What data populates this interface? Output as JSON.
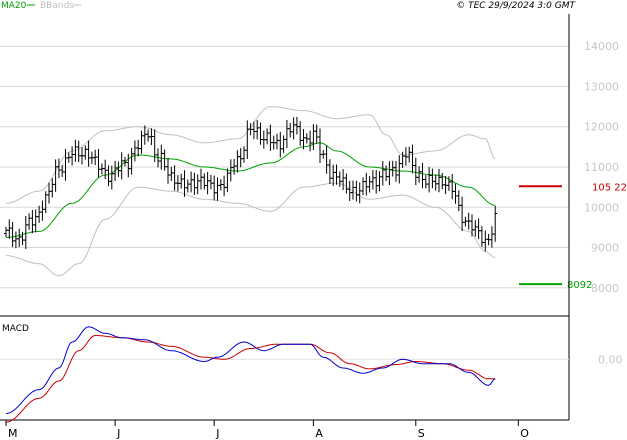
{
  "header": {
    "legend": [
      {
        "label": "MA20",
        "color": "#00a000"
      },
      {
        "label": "BBands",
        "color": "#c0c0c0"
      }
    ],
    "source": "© TEC 29/9/2024 3:0 GMT"
  },
  "colors": {
    "price_bar": "#000000",
    "ma20": "#00a000",
    "bbands": "#c0c0c0",
    "grid": "#d8d8d8",
    "macd": "#0000cc",
    "signal": "#cc0000",
    "resistance": "#cc0000",
    "support": "#00a000"
  },
  "macd_pane": {
    "title": "MACD",
    "tick_label": "0.00"
  },
  "levels": {
    "resistance": {
      "value": 10522,
      "label": "105 22"
    },
    "support": {
      "value": 8092,
      "label": "8092"
    }
  },
  "chart_data": {
    "type": "ohlc",
    "y_ticks": [
      {
        "value": 8000,
        "label": "8000"
      },
      {
        "value": 9000,
        "label": "9000"
      },
      {
        "value": 10000,
        "label": "10000"
      },
      {
        "value": 11000,
        "label": "11000"
      },
      {
        "value": 12000,
        "label": "12000"
      },
      {
        "value": 13000,
        "label": "13000"
      },
      {
        "value": 14000,
        "label": "14000"
      }
    ],
    "ylim": [
      7300,
      14800
    ],
    "x_labels": [
      "M",
      "J",
      "J",
      "A",
      "S",
      "O"
    ],
    "x_label_index": [
      0,
      33,
      63,
      93,
      124,
      155
    ],
    "n_bars": 155,
    "price_knots": [
      [
        0,
        9350
      ],
      [
        4,
        9250
      ],
      [
        8,
        9650
      ],
      [
        12,
        10200
      ],
      [
        16,
        11000
      ],
      [
        20,
        11300
      ],
      [
        24,
        11400
      ],
      [
        28,
        11000
      ],
      [
        32,
        10800
      ],
      [
        36,
        11100
      ],
      [
        40,
        11500
      ],
      [
        43,
        11900
      ],
      [
        46,
        11200
      ],
      [
        50,
        10800
      ],
      [
        54,
        10500
      ],
      [
        58,
        10700
      ],
      [
        62,
        10500
      ],
      [
        66,
        10600
      ],
      [
        70,
        11200
      ],
      [
        74,
        11900
      ],
      [
        78,
        11800
      ],
      [
        82,
        11500
      ],
      [
        86,
        12000
      ],
      [
        90,
        11700
      ],
      [
        93,
        11800
      ],
      [
        96,
        11200
      ],
      [
        99,
        10800
      ],
      [
        103,
        10500
      ],
      [
        107,
        10400
      ],
      [
        111,
        10700
      ],
      [
        115,
        10800
      ],
      [
        118,
        11000
      ],
      [
        121,
        11300
      ],
      [
        124,
        10900
      ],
      [
        128,
        10600
      ],
      [
        132,
        10700
      ],
      [
        135,
        10400
      ],
      [
        138,
        9800
      ],
      [
        141,
        9500
      ],
      [
        143,
        9300
      ],
      [
        146,
        9200
      ],
      [
        148,
        9700
      ]
    ],
    "ma20_knots": [
      [
        0,
        9250
      ],
      [
        10,
        9400
      ],
      [
        20,
        10100
      ],
      [
        30,
        10800
      ],
      [
        40,
        11300
      ],
      [
        50,
        11200
      ],
      [
        60,
        11000
      ],
      [
        70,
        10900
      ],
      [
        80,
        11100
      ],
      [
        90,
        11500
      ],
      [
        95,
        11600
      ],
      [
        100,
        11400
      ],
      [
        110,
        11000
      ],
      [
        120,
        10900
      ],
      [
        130,
        10800
      ],
      [
        140,
        10500
      ],
      [
        148,
        10050
      ]
    ],
    "bb_upper_knots": [
      [
        0,
        10100
      ],
      [
        10,
        10400
      ],
      [
        20,
        11400
      ],
      [
        30,
        11900
      ],
      [
        40,
        12000
      ],
      [
        50,
        11800
      ],
      [
        60,
        11600
      ],
      [
        70,
        11700
      ],
      [
        80,
        12500
      ],
      [
        90,
        12400
      ],
      [
        100,
        12200
      ],
      [
        110,
        12300
      ],
      [
        115,
        11800
      ],
      [
        120,
        11300
      ],
      [
        130,
        11400
      ],
      [
        140,
        11800
      ],
      [
        145,
        11700
      ],
      [
        148,
        11200
      ]
    ],
    "bb_lower_knots": [
      [
        0,
        8800
      ],
      [
        10,
        8600
      ],
      [
        16,
        8300
      ],
      [
        22,
        8600
      ],
      [
        30,
        9700
      ],
      [
        40,
        10500
      ],
      [
        50,
        10400
      ],
      [
        60,
        10200
      ],
      [
        70,
        10100
      ],
      [
        80,
        9900
      ],
      [
        90,
        10500
      ],
      [
        100,
        10600
      ],
      [
        110,
        10200
      ],
      [
        120,
        10300
      ],
      [
        130,
        10000
      ],
      [
        140,
        9400
      ],
      [
        145,
        8900
      ],
      [
        148,
        8750
      ]
    ],
    "macd_ylim": [
      -1.4,
      1.0
    ],
    "macd_knots": [
      [
        0,
        -1.25
      ],
      [
        10,
        -0.7
      ],
      [
        16,
        -0.2
      ],
      [
        20,
        0.4
      ],
      [
        25,
        0.75
      ],
      [
        30,
        0.6
      ],
      [
        35,
        0.5
      ],
      [
        42,
        0.45
      ],
      [
        50,
        0.2
      ],
      [
        60,
        -0.05
      ],
      [
        64,
        0.05
      ],
      [
        72,
        0.4
      ],
      [
        78,
        0.2
      ],
      [
        84,
        0.35
      ],
      [
        92,
        0.35
      ],
      [
        96,
        0.05
      ],
      [
        102,
        -0.2
      ],
      [
        108,
        -0.32
      ],
      [
        114,
        -0.2
      ],
      [
        120,
        0.0
      ],
      [
        126,
        -0.1
      ],
      [
        134,
        -0.1
      ],
      [
        140,
        -0.3
      ],
      [
        146,
        -0.6
      ],
      [
        148,
        -0.45
      ]
    ],
    "signal_knots": [
      [
        0,
        -1.45
      ],
      [
        10,
        -0.9
      ],
      [
        16,
        -0.5
      ],
      [
        22,
        0.2
      ],
      [
        27,
        0.55
      ],
      [
        35,
        0.5
      ],
      [
        43,
        0.4
      ],
      [
        50,
        0.3
      ],
      [
        60,
        0.05
      ],
      [
        66,
        0.0
      ],
      [
        74,
        0.25
      ],
      [
        82,
        0.35
      ],
      [
        92,
        0.35
      ],
      [
        98,
        0.15
      ],
      [
        104,
        -0.1
      ],
      [
        110,
        -0.22
      ],
      [
        118,
        -0.12
      ],
      [
        124,
        -0.05
      ],
      [
        132,
        -0.1
      ],
      [
        140,
        -0.25
      ],
      [
        146,
        -0.45
      ],
      [
        148,
        -0.45
      ]
    ]
  }
}
